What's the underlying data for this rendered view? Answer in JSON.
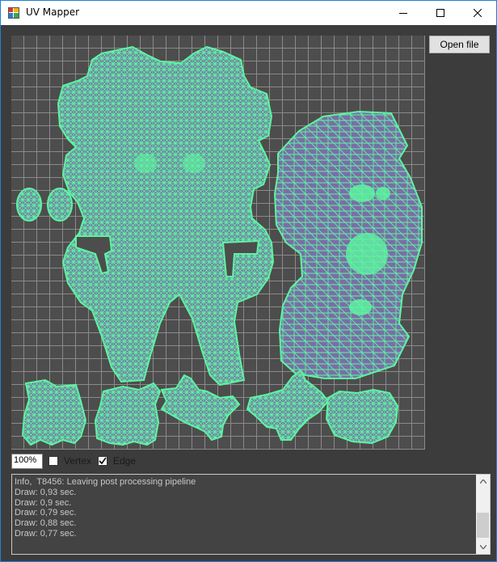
{
  "window": {
    "title": "UV Mapper",
    "icon": "app-icon",
    "controls": [
      "minimize-icon",
      "maximize-icon",
      "close-icon"
    ]
  },
  "toolbar": {
    "open_label": "Open file"
  },
  "view": {
    "zoom_value": "100%",
    "vertex_label": "Vertex",
    "vertex_checked": false,
    "edge_label": "Edge",
    "edge_checked": true
  },
  "colors": {
    "mesh_fill": "#7a6ea8",
    "mesh_edge": "#5df5a0",
    "canvas_bg": "#4d4d4d",
    "grid": "#8a8a8a",
    "window_bg": "#3c3c3c"
  },
  "log": {
    "lines": [
      "Info,  T8456: Leaving post processing pipeline",
      "Draw: 0,93 sec.",
      "Draw: 0,9 sec.",
      "Draw: 0,79 sec.",
      "Draw: 0,88 sec.",
      "Draw: 0,77 sec."
    ],
    "scrollbar_position": 0.65
  }
}
